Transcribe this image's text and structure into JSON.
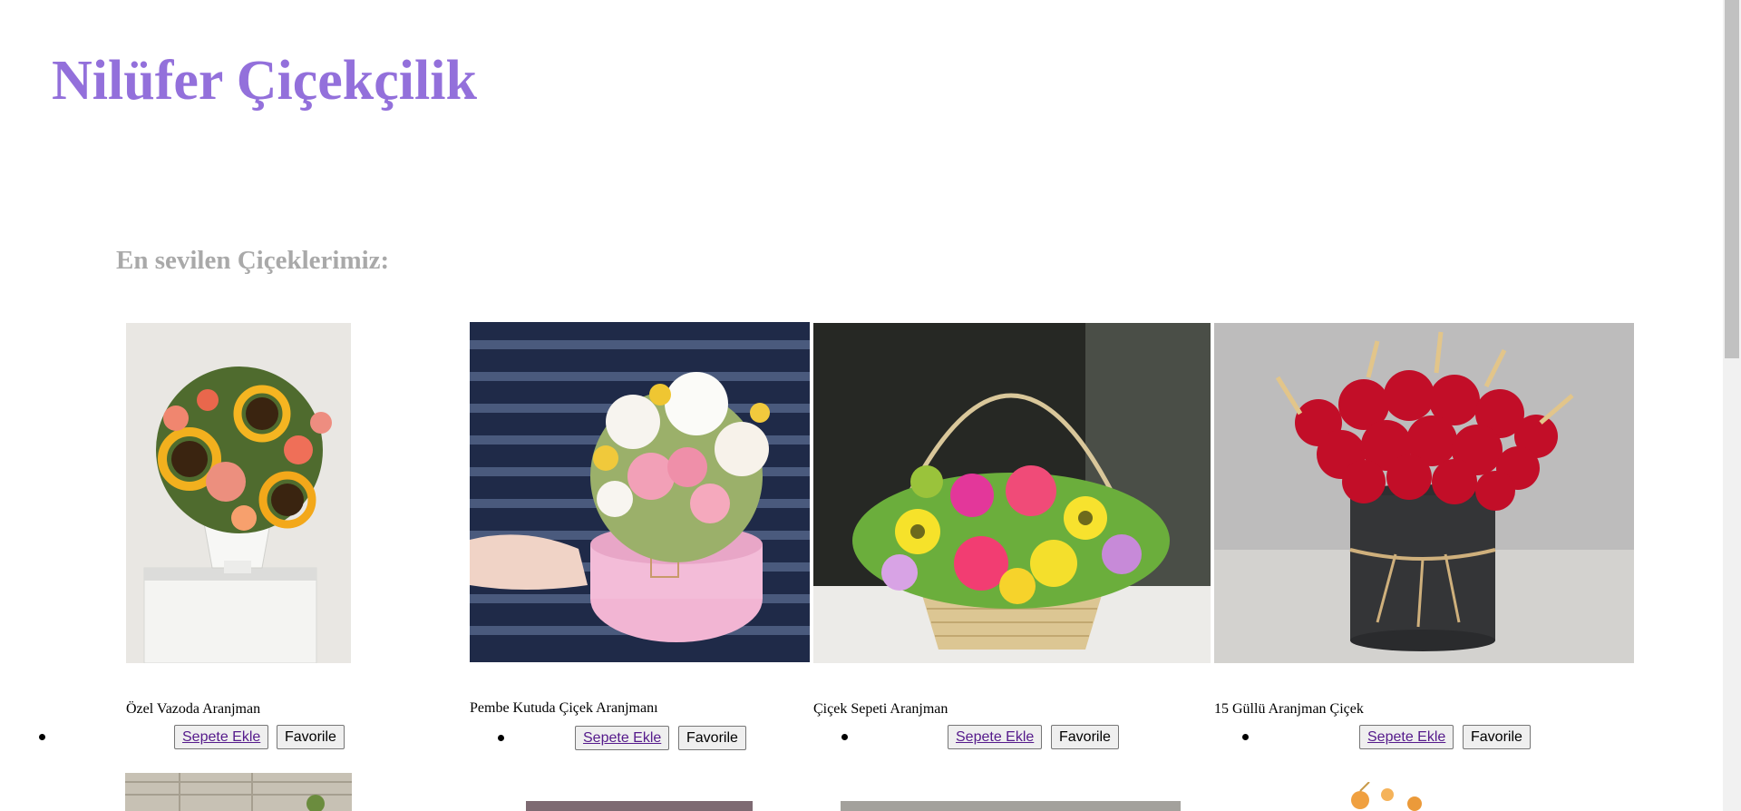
{
  "site": {
    "title": "Nilüfer Çiçekçilik"
  },
  "section": {
    "title": "En sevilen Çiçeklerimiz:"
  },
  "products": [
    {
      "name": "Özel Vazoda Aranjman",
      "add_to_cart": "Sepete Ekle",
      "favorite": "Favorile"
    },
    {
      "name": "Pembe Kutuda Çiçek Aranjmanı",
      "add_to_cart": "Sepete Ekle",
      "favorite": "Favorile"
    },
    {
      "name": "Çiçek Sepeti Aranjman",
      "add_to_cart": "Sepete Ekle",
      "favorite": "Favorile"
    },
    {
      "name": "15 Güllü Aranjman Çiçek",
      "add_to_cart": "Sepete Ekle",
      "favorite": "Favorile"
    }
  ],
  "colors": {
    "title": "#9370db",
    "section_title": "#a9a9a9",
    "link": "#551a8b"
  }
}
